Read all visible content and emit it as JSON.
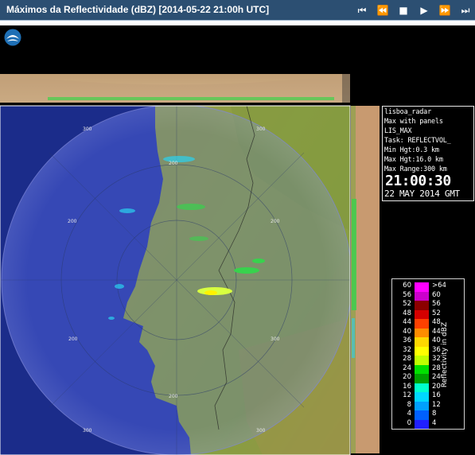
{
  "window": {
    "title": "Máximos da Reflectividade (dBZ) [2014-05-22 21:00h UTC]"
  },
  "controls": [
    {
      "name": "first",
      "glyph": "⏮"
    },
    {
      "name": "prev",
      "glyph": "⏪"
    },
    {
      "name": "stop",
      "glyph": "■"
    },
    {
      "name": "play",
      "glyph": "▶"
    },
    {
      "name": "next",
      "glyph": "⏩"
    },
    {
      "name": "last",
      "glyph": "⏭"
    }
  ],
  "info": {
    "radar": "lisboa_radar",
    "product": "Max with panels",
    "id": "LIS_MAX",
    "task": "Task: REFLECTVOL_",
    "min_hgt": "Min Hgt:0.3 km",
    "max_hgt": "Max Hgt:16.0 km",
    "max_range": "Max Range:300 km",
    "time": "21:00:30",
    "date": "22 MAY 2014 GMT"
  },
  "range_labels": [
    "300",
    "200",
    "200",
    "200",
    "200",
    "300",
    "300",
    "300",
    "200",
    "300"
  ],
  "legend": {
    "title": "Reflectivity in dBZ",
    "rows": [
      {
        "left": "60",
        "right": ">64",
        "color": "#ff00ff"
      },
      {
        "left": "56",
        "right": "60",
        "color": "#cc00cc"
      },
      {
        "left": "52",
        "right": "56",
        "color": "#8b0000"
      },
      {
        "left": "48",
        "right": "52",
        "color": "#d40000"
      },
      {
        "left": "44",
        "right": "48",
        "color": "#ff4000"
      },
      {
        "left": "40",
        "right": "44",
        "color": "#ff8c00"
      },
      {
        "left": "36",
        "right": "40",
        "color": "#ffd700"
      },
      {
        "left": "32",
        "right": "36",
        "color": "#ffff00"
      },
      {
        "left": "28",
        "right": "32",
        "color": "#bfff00"
      },
      {
        "left": "24",
        "right": "28",
        "color": "#00e000"
      },
      {
        "left": "20",
        "right": "24",
        "color": "#00a000"
      },
      {
        "left": "16",
        "right": "20",
        "color": "#00ffcc"
      },
      {
        "left": "12",
        "right": "16",
        "color": "#00d8ff"
      },
      {
        "left": "8",
        "right": "12",
        "color": "#00a0ff"
      },
      {
        "left": "4",
        "right": "8",
        "color": "#0060ff"
      },
      {
        "left": "0",
        "right": "4",
        "color": "#2020ff"
      }
    ]
  }
}
